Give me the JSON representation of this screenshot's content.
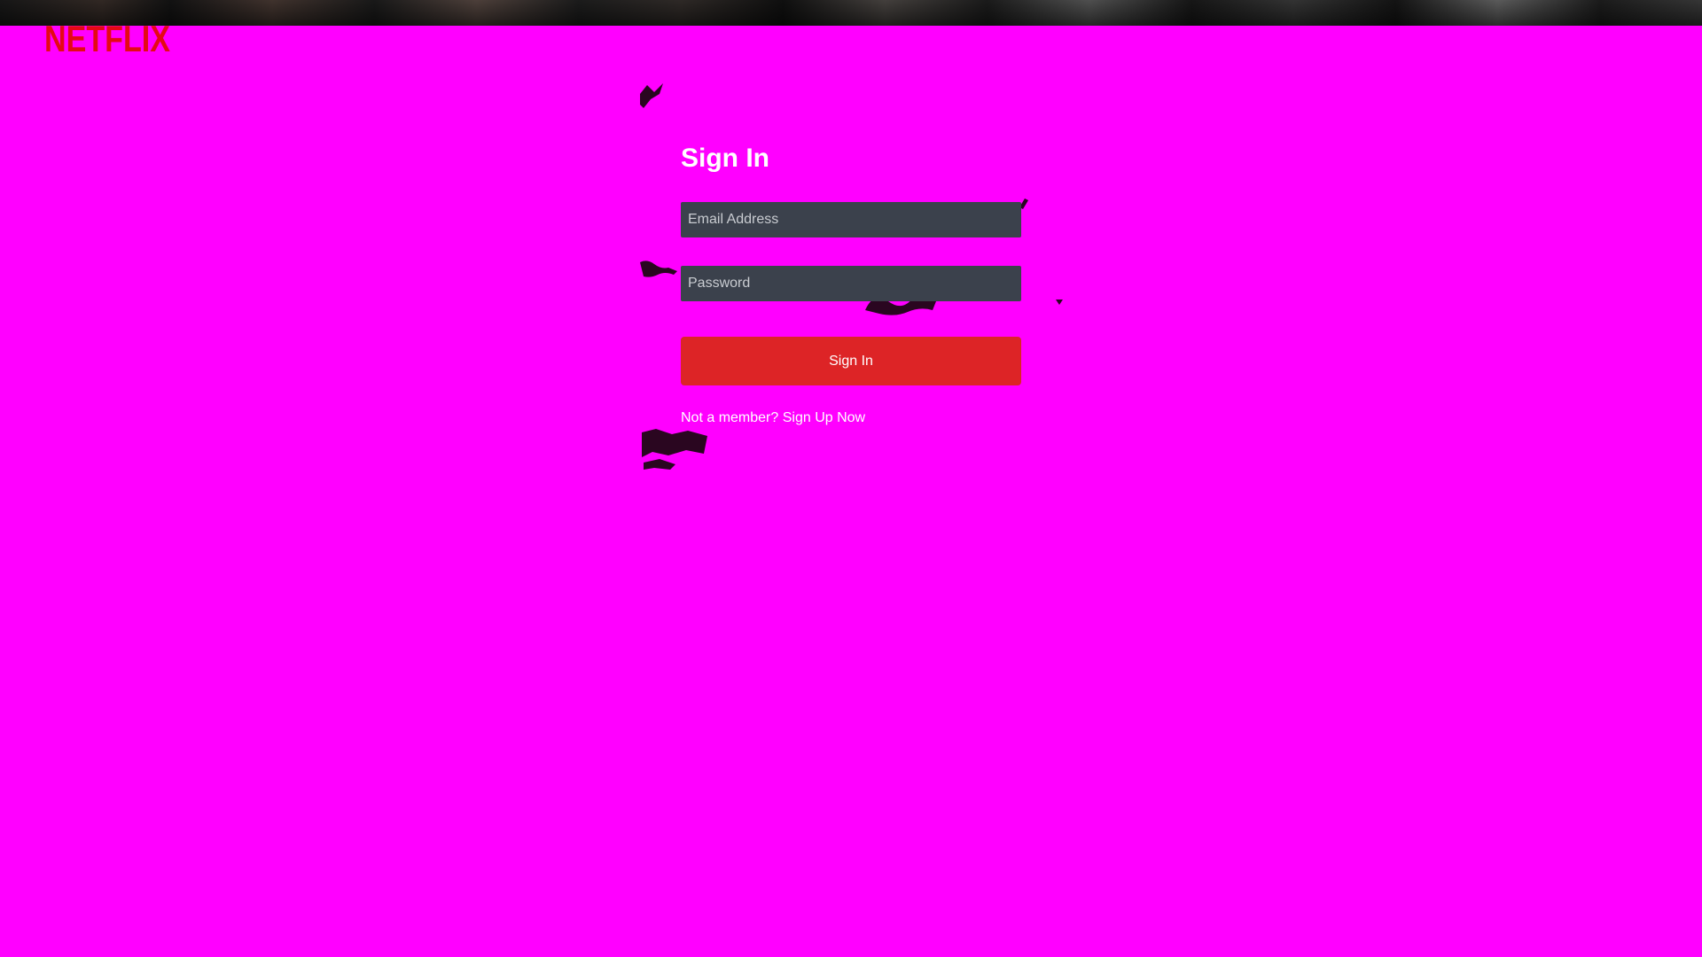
{
  "brand": {
    "logo_text": "NETFLIX",
    "logo_color": "#e50914"
  },
  "signin": {
    "title": "Sign In",
    "email_placeholder": "Email Address",
    "email_value": "",
    "password_placeholder": "Password",
    "password_value": "",
    "submit_label": "Sign In",
    "signup_prompt": "Not a member?",
    "signup_link": "Sign Up Now"
  },
  "colors": {
    "page_background": "#ff00ff",
    "input_background": "#3b414c",
    "button_background": "#dd2426",
    "text": "#ffffff"
  }
}
